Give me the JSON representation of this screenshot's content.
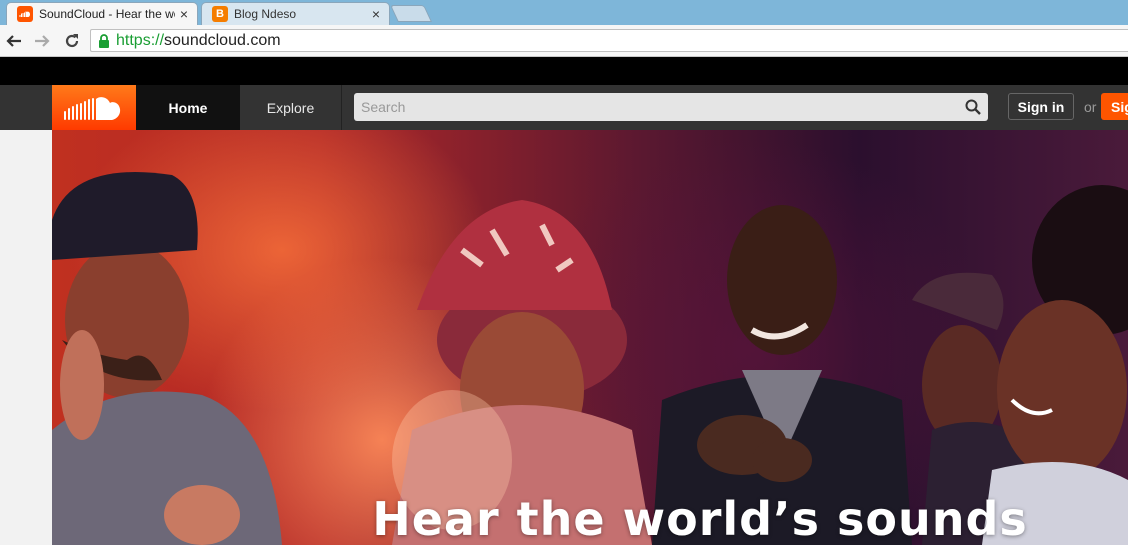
{
  "browser": {
    "tabs": [
      {
        "title": "SoundCloud - Hear the wo",
        "active": true,
        "favicon": "soundcloud-icon"
      },
      {
        "title": "Blog Ndeso",
        "active": false,
        "favicon": "blogger-icon"
      }
    ],
    "close_glyph": "×",
    "favicon_letter": "B",
    "url_scheme": "https://",
    "url_host": "soundcloud.com"
  },
  "header": {
    "nav": [
      {
        "label": "Home"
      },
      {
        "label": "Explore"
      }
    ],
    "search_placeholder": "Search",
    "signin_label": "Sign in",
    "or_label": "or",
    "signup_label": "Sig",
    "brand_color": "#ff5500"
  },
  "hero": {
    "title": "Hear the world’s sounds"
  }
}
